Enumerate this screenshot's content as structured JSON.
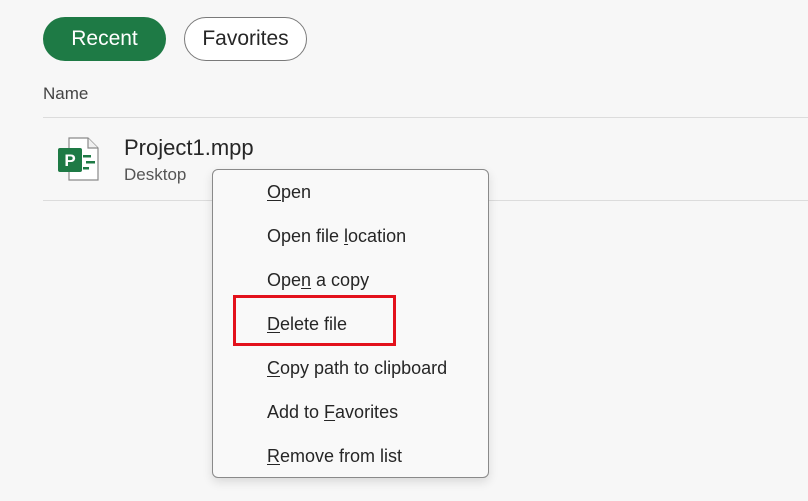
{
  "tabs": {
    "recent_label": "Recent",
    "favorites_label": "Favorites"
  },
  "list": {
    "column_header": "Name",
    "files": [
      {
        "name": "Project1.mpp",
        "location": "Desktop",
        "icon": "project-file-icon",
        "icon_letter": "P"
      }
    ]
  },
  "context_menu": {
    "items": [
      {
        "pre": "",
        "mnemonic": "O",
        "post": "pen"
      },
      {
        "pre": "Open file ",
        "mnemonic": "l",
        "post": "ocation"
      },
      {
        "pre": "Ope",
        "mnemonic": "n",
        "post": " a copy"
      },
      {
        "pre": "",
        "mnemonic": "D",
        "post": "elete file"
      },
      {
        "pre": "",
        "mnemonic": "C",
        "post": "opy path to clipboard"
      },
      {
        "pre": "Add to ",
        "mnemonic": "F",
        "post": "avorites"
      },
      {
        "pre": "",
        "mnemonic": "R",
        "post": "emove from list"
      }
    ],
    "highlighted_item": "Delete file"
  },
  "colors": {
    "accent_green": "#1e7a45",
    "highlight_red": "#e3121c"
  }
}
